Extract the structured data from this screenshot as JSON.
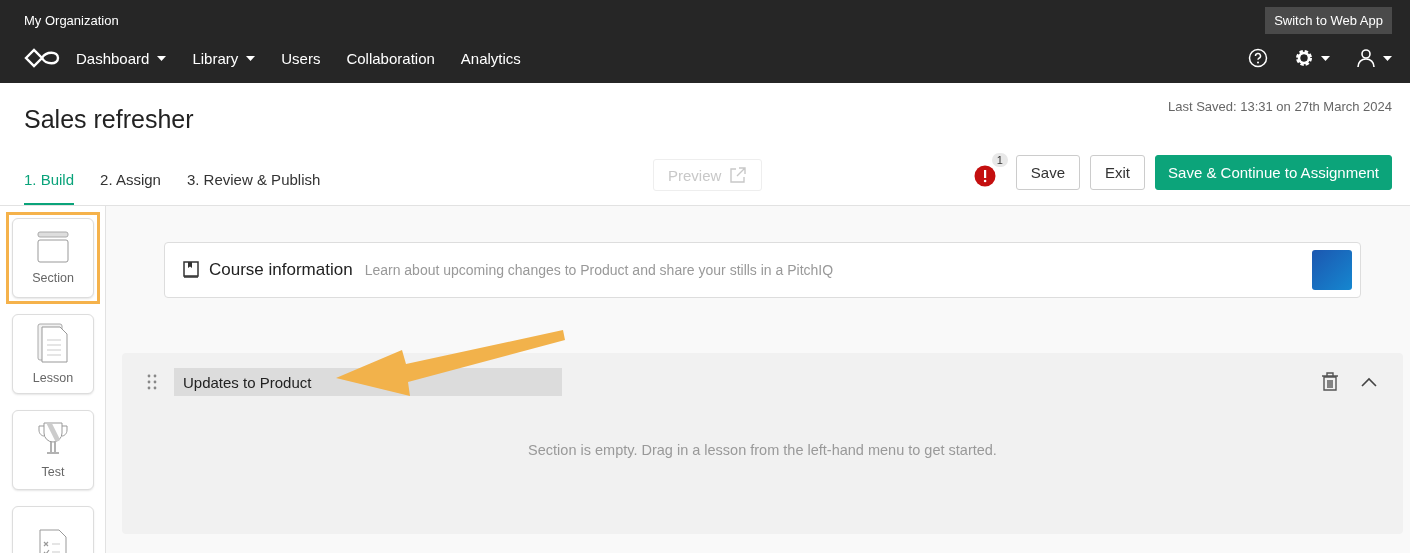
{
  "top_bar": {
    "organization": "My Organization",
    "switch_button": "Switch to Web App",
    "nav": [
      {
        "label": "Dashboard",
        "dropdown": true
      },
      {
        "label": "Library",
        "dropdown": true
      },
      {
        "label": "Users",
        "dropdown": false
      },
      {
        "label": "Collaboration",
        "dropdown": false
      },
      {
        "label": "Analytics",
        "dropdown": false
      }
    ]
  },
  "header": {
    "title": "Sales refresher",
    "last_saved": "Last Saved: 13:31 on 27th March 2024",
    "steps": [
      {
        "label": "1. Build",
        "selected": true
      },
      {
        "label": "2. Assign",
        "selected": false
      },
      {
        "label": "3. Review & Publish",
        "selected": false
      }
    ],
    "preview_button": {
      "label": "Preview",
      "disabled": true
    },
    "alert_count": "1",
    "buttons": [
      {
        "label": "Save",
        "kind": "outline"
      },
      {
        "label": "Exit",
        "kind": "outline"
      },
      {
        "label": "Save & Continue to Assignment",
        "kind": "primary"
      }
    ]
  },
  "toolbox": [
    {
      "label": "Section",
      "kind": "section",
      "selected": true
    },
    {
      "label": "Lesson",
      "kind": "lesson",
      "selected": false
    },
    {
      "label": "Test",
      "kind": "test",
      "selected": false
    },
    {
      "kind": "survey",
      "selected": false
    }
  ],
  "course_info": {
    "title": "Course information",
    "description": "Learn about upcoming changes to Product and share your stills in a PitchIQ"
  },
  "section": {
    "title_value": "Updates to Product",
    "empty_message": "Section is empty. Drag in a lesson from the left-hand menu to get started.",
    "expanded": true
  }
}
